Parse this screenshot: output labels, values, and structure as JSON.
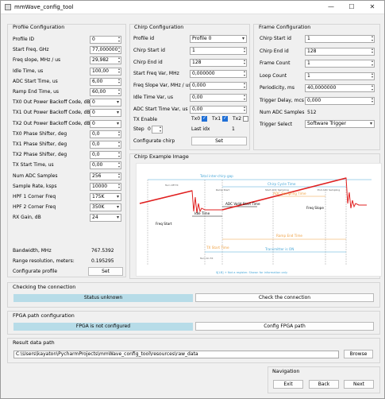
{
  "window": {
    "title": "mmWave_config_tool",
    "minimize": "—",
    "maximize": "☐",
    "close": "✕"
  },
  "profile": {
    "title": "Profile Configuration",
    "rows": [
      {
        "label": "Profile ID",
        "value": "0"
      },
      {
        "label": "Start Freq, GHz",
        "value": "77,000000"
      },
      {
        "label": "Freq slope, MHz / us",
        "value": "29,982"
      },
      {
        "label": "Idle Time, us",
        "value": "100,00"
      },
      {
        "label": "ADC Start Time, us",
        "value": "6,00"
      },
      {
        "label": "Ramp End Time, us",
        "value": "60,00"
      },
      {
        "label": "TX0 Out Power Backoff Code, dB",
        "value": "0"
      },
      {
        "label": "TX1 Out Power Backoff Code, dB",
        "value": "0"
      },
      {
        "label": "TX2 Out Power Backoff Code, dB",
        "value": "0"
      },
      {
        "label": "TX0 Phase Shifter, deg",
        "value": "0,0"
      },
      {
        "label": "TX1 Phase Shifter, deg",
        "value": "0,0"
      },
      {
        "label": "TX2 Phase Shifter, deg",
        "value": "0,0"
      },
      {
        "label": "TX Start Time, us",
        "value": "0,00"
      },
      {
        "label": "Num ADC Samples",
        "value": "256"
      },
      {
        "label": "Sample Rate, ksps",
        "value": "10000"
      },
      {
        "label": "HPF 1 Corner Freq",
        "value": "175K"
      },
      {
        "label": "HPF 2 Corner Freq",
        "value": "350K"
      },
      {
        "label": "RX Gain, dB",
        "value": "24"
      }
    ],
    "bandwidth_label": "Bandwidth, MHz",
    "bandwidth_value": "767.5392",
    "range_label": "Range resolution, meters:",
    "range_value": "0.195295",
    "configure_label": "Configurate profile",
    "set_label": "Set"
  },
  "chirp": {
    "title": "Chirp Configuration",
    "rows": [
      {
        "label": "Profile id",
        "value": "Profile 0"
      },
      {
        "label": "Chirp Start id",
        "value": "1"
      },
      {
        "label": "Chirp End id",
        "value": "128"
      },
      {
        "label": "Start Freq Var, MHz",
        "value": "0,000000"
      },
      {
        "label": "Freq Slope Var, MHz / us",
        "value": "0,000"
      },
      {
        "label": "Idle Time Var, us",
        "value": "0,00"
      },
      {
        "label": "ADC Start Time Var, us",
        "value": "0,00"
      }
    ],
    "tx_enable_label": "TX Enable",
    "tx0": "Tx0",
    "tx1": "Tx1",
    "tx2": "Tx2",
    "step_label": "Step",
    "step_value": "0",
    "last_idx_label": "Last idx",
    "last_idx_value": "1",
    "configure_label": "Configurate chirp",
    "set_label": "Set"
  },
  "frame": {
    "title": "Frame Configuration",
    "rows": [
      {
        "label": "Chirp Start id",
        "value": "1"
      },
      {
        "label": "Chirp End id",
        "value": "128"
      },
      {
        "label": "Frame Count",
        "value": "1"
      },
      {
        "label": "Loop Count",
        "value": "1"
      },
      {
        "label": "Periodicity, ms",
        "value": "40,0000000"
      },
      {
        "label": "Trigger Delay, mcs",
        "value": "0,000"
      }
    ],
    "num_adc_label": "Num ADC Samples",
    "num_adc_value": "512",
    "trigger_label": "Trigger Select",
    "trigger_value": "Software Trigger"
  },
  "example": {
    "title": "Chirp Example Image",
    "labels": {
      "total_gap": "Total inter-chirp gap",
      "chirp_cycle": "Chirp Cycle Time",
      "idle_time": "Idle Time",
      "adc_valid": "ADC Valid Start Time",
      "freq_slope": "Freq Slope",
      "adc_sampling": "ADC Sampling Time",
      "freq_start": "Freq Start",
      "ramp_end": "Ramp End Time",
      "tx_start": "TX Start Time",
      "transmitter_on": "Transmitter is ON",
      "ramp_start": "Ramp Start",
      "start_adc": "Start ADC Sampling",
      "end_adc": "End ADC Sampling",
      "turn_off_tx": "Turn Off TX",
      "turn_on_tx": "Turn On TX",
      "footnote": "$[LB] + Not a register. Shown for information only"
    }
  },
  "connection": {
    "title": "Checking the connection",
    "status": "Status unknown",
    "button": "Check the connection"
  },
  "fpga": {
    "title": "FPGA path configuration",
    "status": "FPGA is not configured",
    "button": "Config FPGA path"
  },
  "result": {
    "title": "Result data path",
    "path": "C:\\Users\\kayaton\\PycharmProjects\\mmWave_config_tool\\resources\\raw_data",
    "browse": "Browse"
  },
  "navigation": {
    "title": "Navigation",
    "exit": "Exit",
    "back": "Back",
    "next": "Next"
  },
  "colors": {
    "status_bg": "#b7dce8",
    "chart_red": "#e02020",
    "chart_orange": "#f0a040",
    "chart_blue": "#4aa8d8"
  }
}
